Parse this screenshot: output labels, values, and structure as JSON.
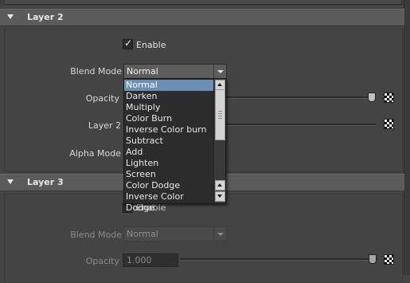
{
  "layer2": {
    "header": "Layer 2",
    "enable_label": "Enable",
    "enable_checked": true,
    "blend_mode_label": "Blend Mode",
    "blend_mode_value": "Normal",
    "opacity_label": "Opacity",
    "layer_label": "Layer 2",
    "alpha_mode_label": "Alpha Mode"
  },
  "blend_dropdown": {
    "options": [
      "Normal",
      "Darken",
      "Multiply",
      "Color Burn",
      "Inverse Color burn",
      "Subtract",
      "Add",
      "Lighten",
      "Screen",
      "Color Dodge",
      "Inverse Color Dodge"
    ],
    "selected": "Normal"
  },
  "layer3": {
    "header": "Layer 3",
    "enable_label": "Enable",
    "enable_checked": false,
    "blend_mode_label": "Blend Mode",
    "blend_mode_value": "Normal",
    "opacity_label": "Opacity",
    "opacity_value": "1.000"
  },
  "colors": {
    "selection": "#6d8fb5",
    "panel": "#444444",
    "header": "#5b5b5b"
  }
}
